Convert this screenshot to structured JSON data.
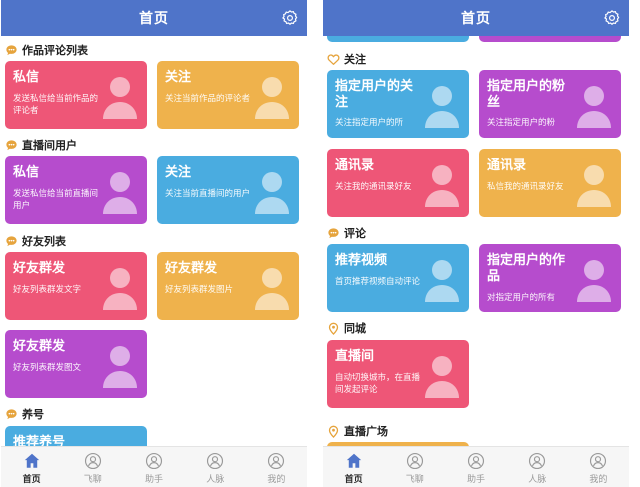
{
  "colors": {
    "header": "#4f74c9",
    "pink": "#ee5677",
    "yellow": "#efb24c",
    "purple": "#b64ccd",
    "blue": "#4aace0",
    "section_icon": "#e6a43d"
  },
  "left": {
    "header_title": "首页",
    "sections": {
      "works": "作品评论列表",
      "live": "直播间用户",
      "friends": "好友列表",
      "raise": "养号"
    },
    "cards": {
      "works_message": {
        "title": "私信",
        "desc": "发送私信给当前作品的评论者"
      },
      "works_follow": {
        "title": "关注",
        "desc": "关注当前作品的评论者"
      },
      "live_message": {
        "title": "私信",
        "desc": "发送私信给当前直播间用户"
      },
      "live_follow": {
        "title": "关注",
        "desc": "关注当前直播间的用户"
      },
      "friends_text": {
        "title": "好友群发",
        "desc": "好友列表群发文字"
      },
      "friends_image": {
        "title": "好友群发",
        "desc": "好友列表群发图片"
      },
      "friends_video": {
        "title": "好友群发",
        "desc": "好友列表群发图文"
      },
      "raise_recommend": {
        "title": "推荐养号"
      }
    }
  },
  "right": {
    "header_title": "首页",
    "sections": {
      "follow": "关注",
      "comment": "评论",
      "city": "同城",
      "plaza": "直播广场"
    },
    "cards": {
      "follow_user_follow": {
        "title": "指定用户的关注",
        "desc": "关注指定用户的所"
      },
      "follow_user_fans": {
        "title": "指定用户的粉丝",
        "desc": "关注指定用户的粉"
      },
      "contacts_a": {
        "title": "通讯录",
        "desc": "关注我的通讯录好友"
      },
      "contacts_b": {
        "title": "通讯录",
        "desc": "私信我的通讯录好友"
      },
      "recommend_video": {
        "title": "推荐视频",
        "desc": "首页推荐视频自动评论"
      },
      "user_works": {
        "title": "指定用户的作品",
        "desc": "对指定用户的所有"
      },
      "live_room": {
        "title": "直播间",
        "desc": "自动切换城市，在直播间发起评论"
      }
    }
  },
  "tabs": [
    "首页",
    "飞聊",
    "助手",
    "人脉",
    "我的"
  ],
  "icons": {
    "gear": "gear-icon",
    "home": "home-icon",
    "chat_bubble": "chat-bubble-icon",
    "heart": "heart-icon",
    "location": "location-pin-icon",
    "user": "user-avatar-icon"
  }
}
